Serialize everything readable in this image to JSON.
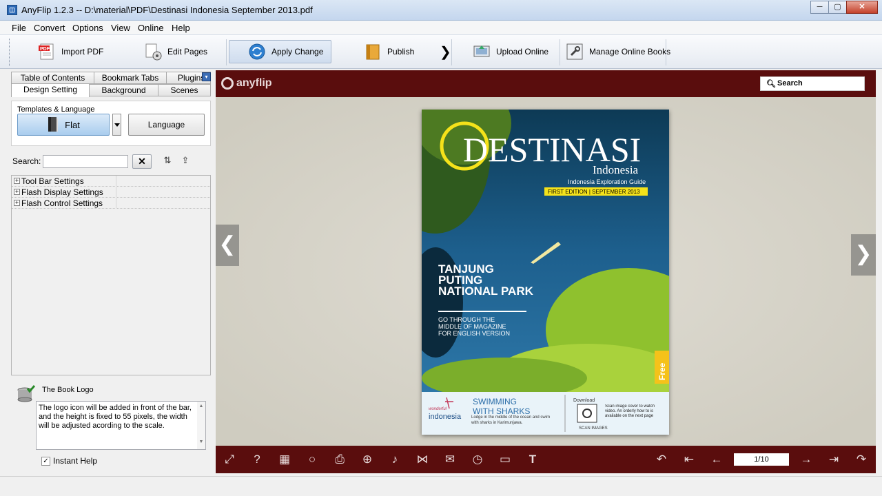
{
  "window": {
    "title": "AnyFlip 1.2.3  -- D:\\material\\PDF\\Destinasi Indonesia September 2013.pdf",
    "controls": [
      "─",
      "▢",
      "✕"
    ]
  },
  "menu": [
    "File",
    "Convert",
    "Options",
    "View",
    "Online",
    "Help"
  ],
  "toolbar": {
    "import_pdf": "Import PDF",
    "edit_pages": "Edit Pages",
    "apply_change": "Apply Change",
    "publish": "Publish",
    "upload_online": "Upload Online",
    "manage_online_books": "Manage Online Books"
  },
  "tabs": {
    "row1": [
      "Table of Contents",
      "Bookmark Tabs",
      "Plugins"
    ],
    "row2": [
      "Design Setting",
      "Background",
      "Scenes"
    ]
  },
  "design": {
    "group_label": "Templates & Language",
    "template_button": "Flat",
    "language_button": "Language"
  },
  "search": {
    "label": "Search:",
    "value": "",
    "clear": "✕"
  },
  "tree": [
    "Tool Bar Settings",
    "Flash Display Settings",
    "Flash Control Settings"
  ],
  "help": {
    "title": "The Book Logo",
    "text": "The logo icon will be added in front of the bar, and the height is fixed to 55 pixels, the width will be adjusted acording to the scale.",
    "instant_help_label": "Instant Help",
    "instant_help_checked": true
  },
  "viewer": {
    "logo_text": "anyflip",
    "search_placeholder": "Search",
    "page_indicator": "1/10",
    "header_color": "#5a0d0d"
  },
  "cover": {
    "masthead": "DESTINASI",
    "subtitle": "Indonesia",
    "guide": "Indonesia Exploration Guide",
    "edition": "FIRST EDITION | SEPTEMBER 2013",
    "headline": "TANJUNG PUTING NATIONAL PARK",
    "subhead": "GO THROUGH THE MIDDLE OF MAGAZINE FOR ENGLISH VERSION",
    "free_badge": "Free",
    "footer_brand_small": "wonderful",
    "footer_brand": "indonesia",
    "feature_title1": "SWIMMING",
    "feature_title2": "WITH SHARKS",
    "feature_text": "Lodge in the middle of the ocean and swim with sharks in Karimunjawa.",
    "download_label": "Download",
    "download_sub": "SCAN IMAGES",
    "scan_text": "Scan image cover to watch video. An orderly how to is available on the next page"
  }
}
